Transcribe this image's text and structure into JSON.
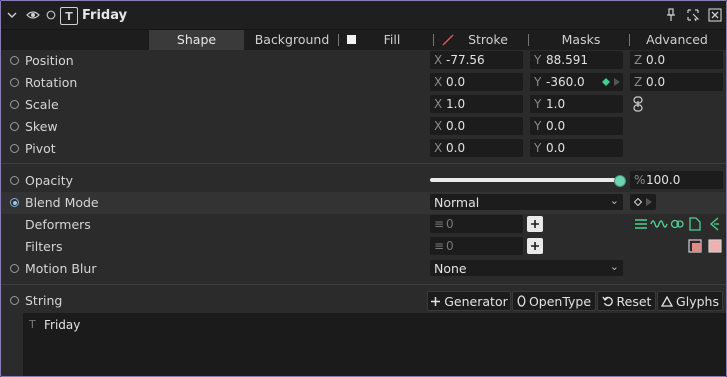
{
  "layer": {
    "name": "Friday",
    "type_icon": "T"
  },
  "tabs": [
    {
      "label": "Shape",
      "active": true
    },
    {
      "label": "Background",
      "active": false
    },
    {
      "label": "Fill",
      "active": false
    },
    {
      "label": "Stroke",
      "active": false
    },
    {
      "label": "Masks",
      "active": false
    },
    {
      "label": "Advanced",
      "active": false
    }
  ],
  "properties": {
    "position": {
      "label": "Position",
      "x_axis": "X",
      "x": "-77.56",
      "y_axis": "Y",
      "y": "88.591",
      "z_axis": "Z",
      "z": "0.0"
    },
    "rotation": {
      "label": "Rotation",
      "x_axis": "X",
      "x": "0.0",
      "y_axis": "Y",
      "y": "-360.0",
      "z_axis": "Z",
      "z": "0.0"
    },
    "scale": {
      "label": "Scale",
      "x_axis": "X",
      "x": "1.0",
      "y_axis": "Y",
      "y": "1.0"
    },
    "skew": {
      "label": "Skew",
      "x_axis": "X",
      "x": "0.0",
      "y_axis": "Y",
      "y": "0.0"
    },
    "pivot": {
      "label": "Pivot",
      "x_axis": "X",
      "x": "0.0",
      "y_axis": "Y",
      "y": "0.0"
    },
    "opacity": {
      "label": "Opacity",
      "unit": "%",
      "value": "100.0",
      "slider_fraction": 1.0
    },
    "blend_mode": {
      "label": "Blend Mode",
      "value": "Normal"
    },
    "deformers": {
      "label": "Deformers",
      "count": "0"
    },
    "filters": {
      "label": "Filters",
      "count": "0"
    },
    "motion_blur": {
      "label": "Motion Blur",
      "value": "None"
    },
    "string": {
      "label": "String",
      "text": "Friday",
      "text_icon": "T"
    }
  },
  "string_buttons": {
    "generator": "Generator",
    "opentype": "OpenType",
    "reset": "Reset",
    "glyphs": "Glyphs"
  },
  "colors": {
    "accent_keyframe": "#3ecf8e",
    "slider_handle": "#6fd3b0",
    "stroke_slash": "#e05a5a",
    "frame_border": "#8a7ab8"
  }
}
